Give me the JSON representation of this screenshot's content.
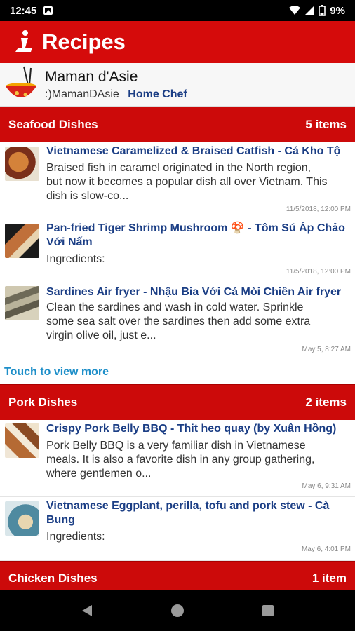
{
  "status_bar": {
    "time": "12:45",
    "battery": "9%"
  },
  "app_bar": {
    "title": "Recipes"
  },
  "profile": {
    "name": "Maman d'Asie",
    "handle": ":)MamanDAsie",
    "role": "Home Chef"
  },
  "sections": [
    {
      "title": "Seafood Dishes",
      "count": "5 items",
      "recipes": [
        {
          "title": "Vietnamese Caramelized & Braised Catfish - Cá Kho Tộ",
          "desc_lines": [
            "Braised fish in caramel originated in the North region,",
            "but now it becomes a popular dish all over Vietnam. This",
            "dish is slow-co..."
          ],
          "date": "11/5/2018, 12:00 PM",
          "thumb_color": "#b5562a"
        },
        {
          "title_lines": [
            "Pan-fried Tiger Shrimp Mushroom 🍄 - Tôm Sú Áp Chảo",
            "Với Nấm"
          ],
          "desc_lines": [
            "Ingredients:"
          ],
          "date": "11/5/2018, 12:00 PM",
          "thumb_color": "#9c5b2e"
        },
        {
          "title": "Sardines Air fryer - Nhậu Bia Với Cá Mòi Chiên Air fryer",
          "desc_lines": [
            "Clean the sardines and wash in cold water. Sprinkle",
            "some sea salt over the sardines then add some extra",
            "virgin olive oil, just e..."
          ],
          "date": "May 5, 8:27 AM",
          "thumb_color": "#8d8064"
        }
      ],
      "view_more": "Touch to view more"
    },
    {
      "title": "Pork Dishes",
      "count": "2 items",
      "recipes": [
        {
          "title": "Crispy Pork Belly BBQ - Thit heo quay (by Xuân Hồng)",
          "desc_lines": [
            "Pork Belly BBQ is a very familiar dish in Vietnamese",
            "meals. It is also a favorite dish in any group gathering,",
            "where gentlemen o..."
          ],
          "date": "May 6, 9:31 AM",
          "thumb_color": "#a0612f"
        },
        {
          "title_lines": [
            "Vietnamese Eggplant, perilla, tofu and pork stew - Cà",
            "Bung"
          ],
          "desc_lines": [
            "Ingredients:"
          ],
          "date": "May 6, 4:01 PM",
          "thumb_color": "#4f8aa0"
        }
      ]
    },
    {
      "title": "Chicken Dishes",
      "count": "1 item"
    }
  ],
  "colors": {
    "app_bar": "#d50b0b",
    "section_header": "#cc0a0a",
    "link_blue": "#1b3e85",
    "view_more": "#1e8fc9"
  },
  "icons": {
    "logo": "chef-logo-icon",
    "avatar": "noodle-bowl-icon",
    "nav_back": "back-triangle-icon",
    "nav_home": "home-circle-icon",
    "nav_recent": "recents-square-icon"
  }
}
